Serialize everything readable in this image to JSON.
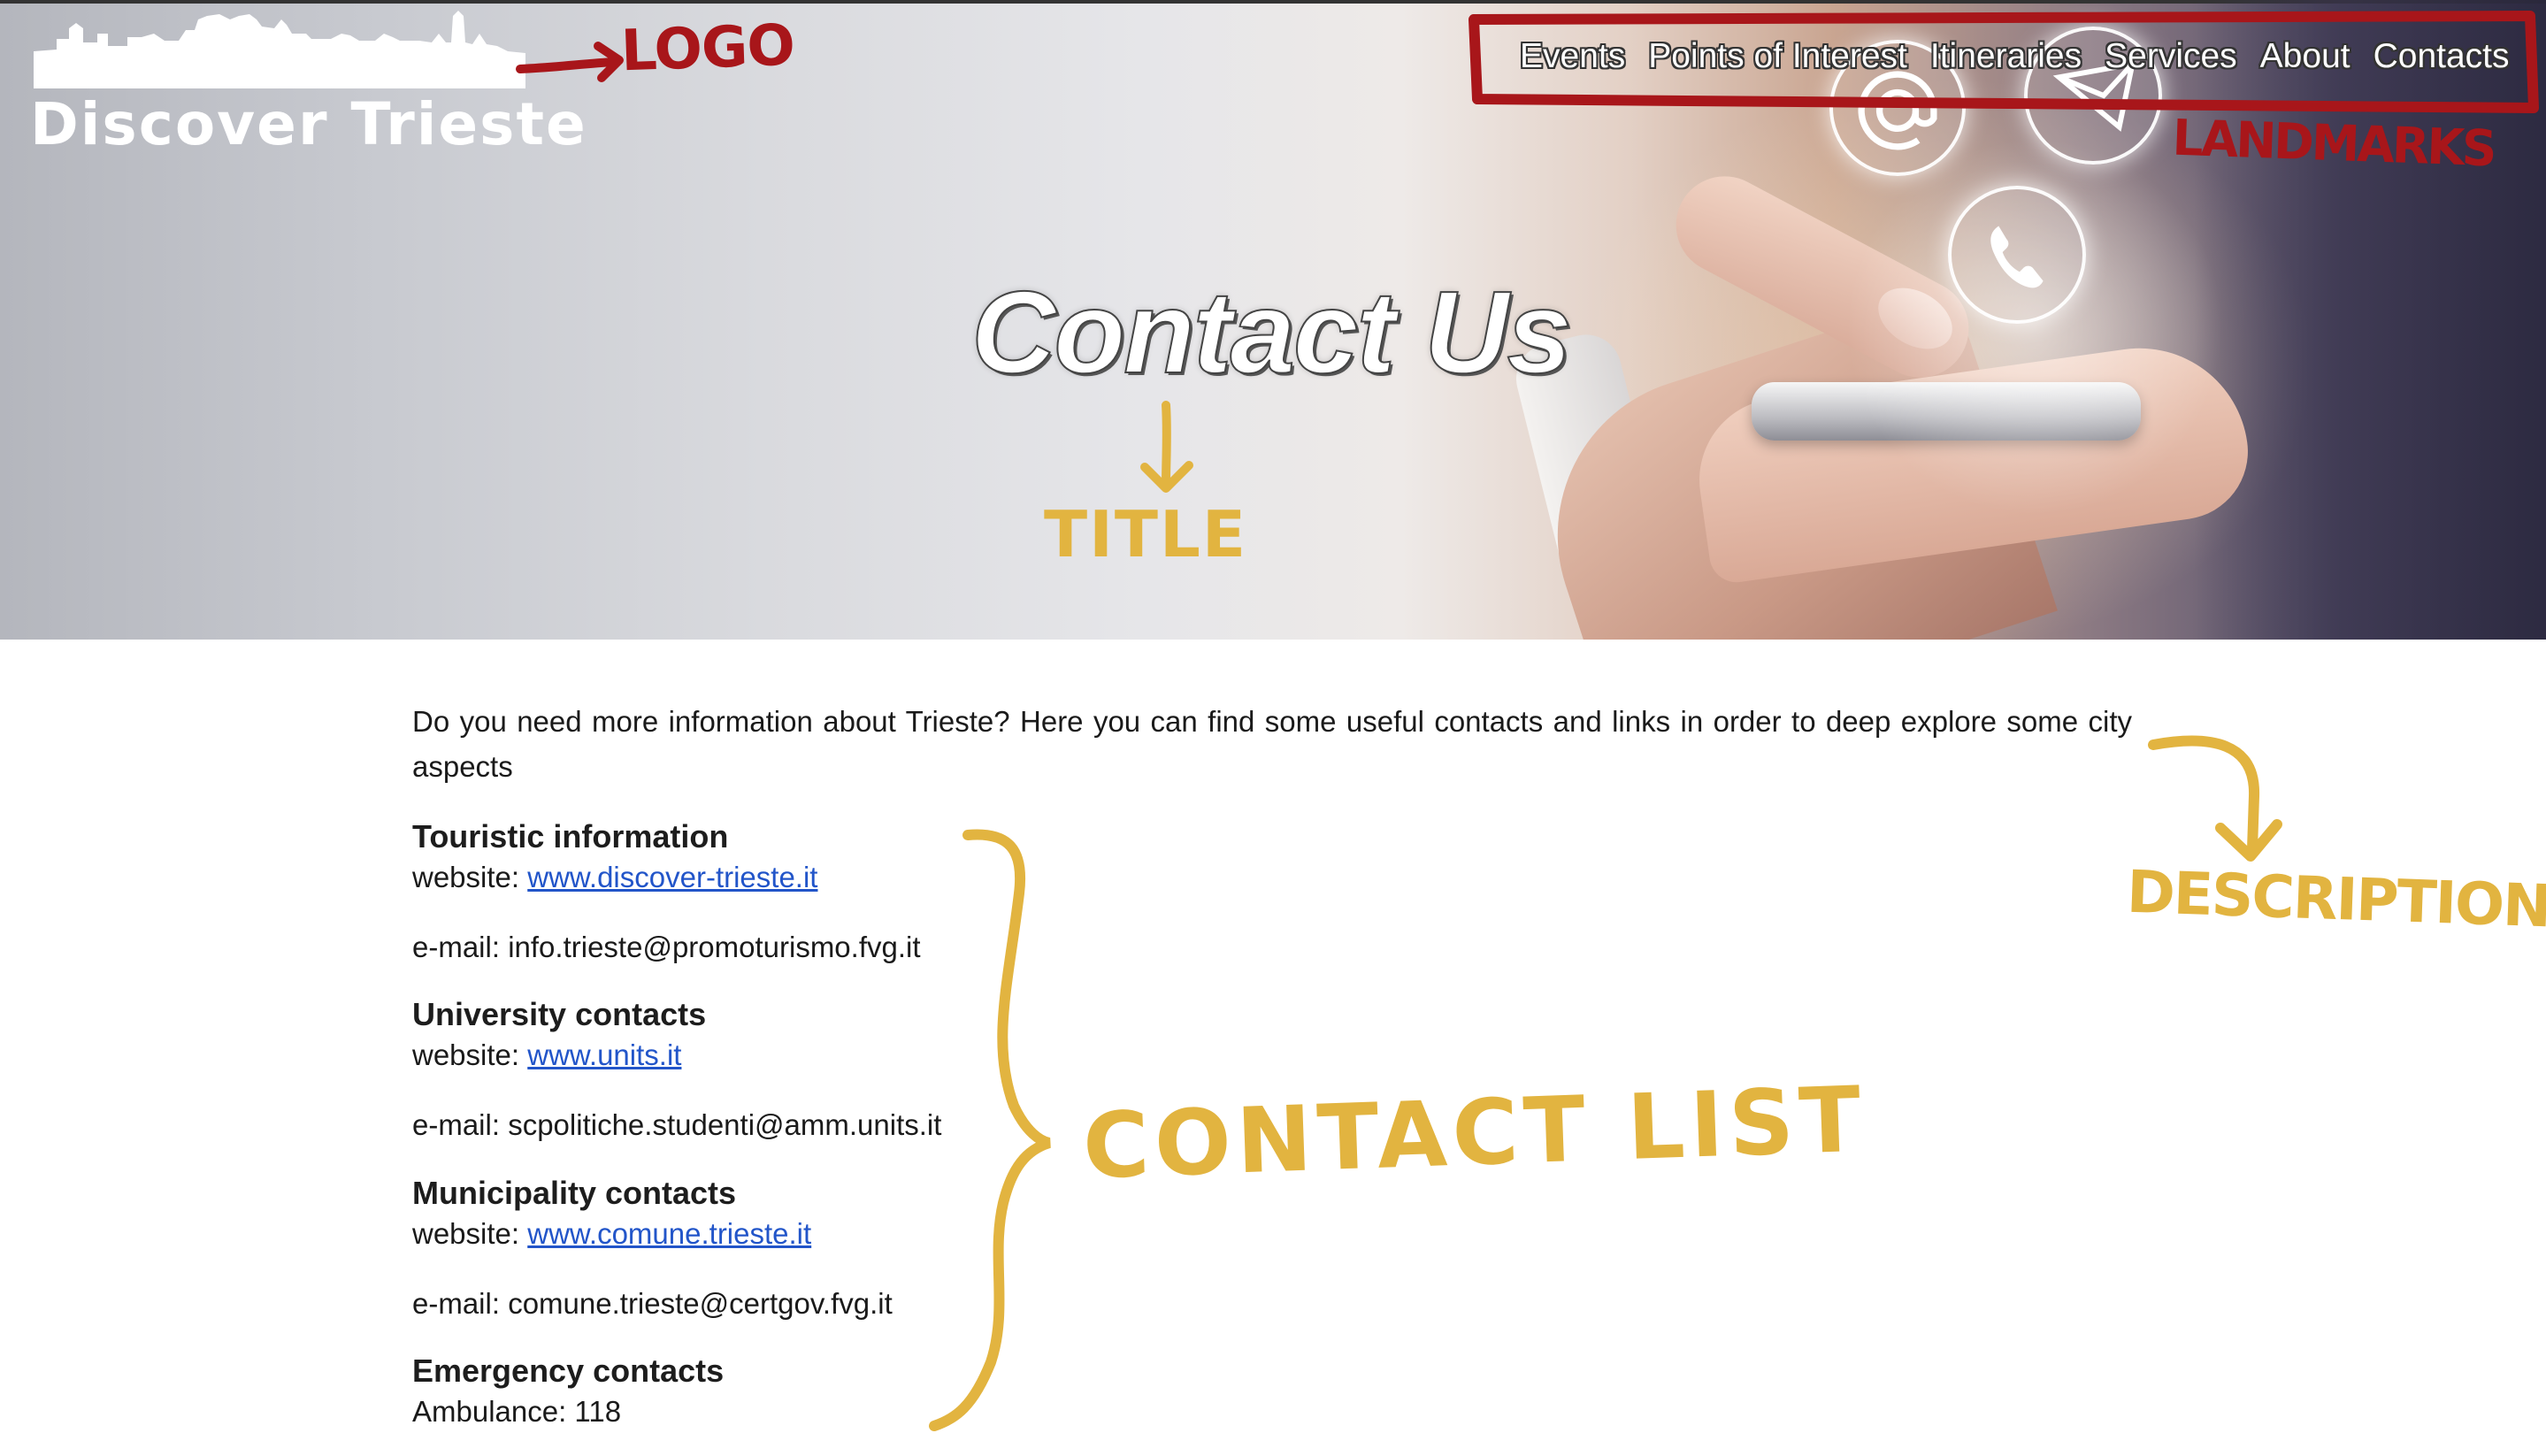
{
  "header": {
    "logo_text": "Discover Trieste",
    "nav": [
      "Events",
      "Points of Interest",
      "Itineraries",
      "Services",
      "About",
      "Contacts"
    ]
  },
  "hero": {
    "title": "Contact Us"
  },
  "main": {
    "description": "Do you need more information about Trieste? Here you can find some useful contacts and links in order to deep explore some city aspects",
    "sections": [
      {
        "title": "Touristic information",
        "website_label": "website:",
        "website": "www.discover-trieste.it",
        "email_label": "e-mail:",
        "email": "info.trieste@promoturismo.fvg.it"
      },
      {
        "title": "University contacts",
        "website_label": "website:",
        "website": "www.units.it",
        "email_label": "e-mail:",
        "email": "scpolitiche.studenti@amm.units.it"
      },
      {
        "title": "Municipality contacts",
        "website_label": "website:",
        "website": "www.comune.trieste.it",
        "email_label": "e-mail:",
        "email": "comune.trieste@certgov.fvg.it"
      },
      {
        "title": "Emergency contacts",
        "line": "Ambulance: 118"
      }
    ]
  },
  "annotations": {
    "logo": "LOGO",
    "landmarks": "LANDMARKS",
    "title": "TITLE",
    "description": "DESCRIPTION",
    "contact_list": "CONTACT LIST",
    "red_color": "#a8161a",
    "yellow_color": "#e2b440"
  },
  "icons": [
    "at-icon",
    "mail-icon",
    "phone-icon"
  ]
}
